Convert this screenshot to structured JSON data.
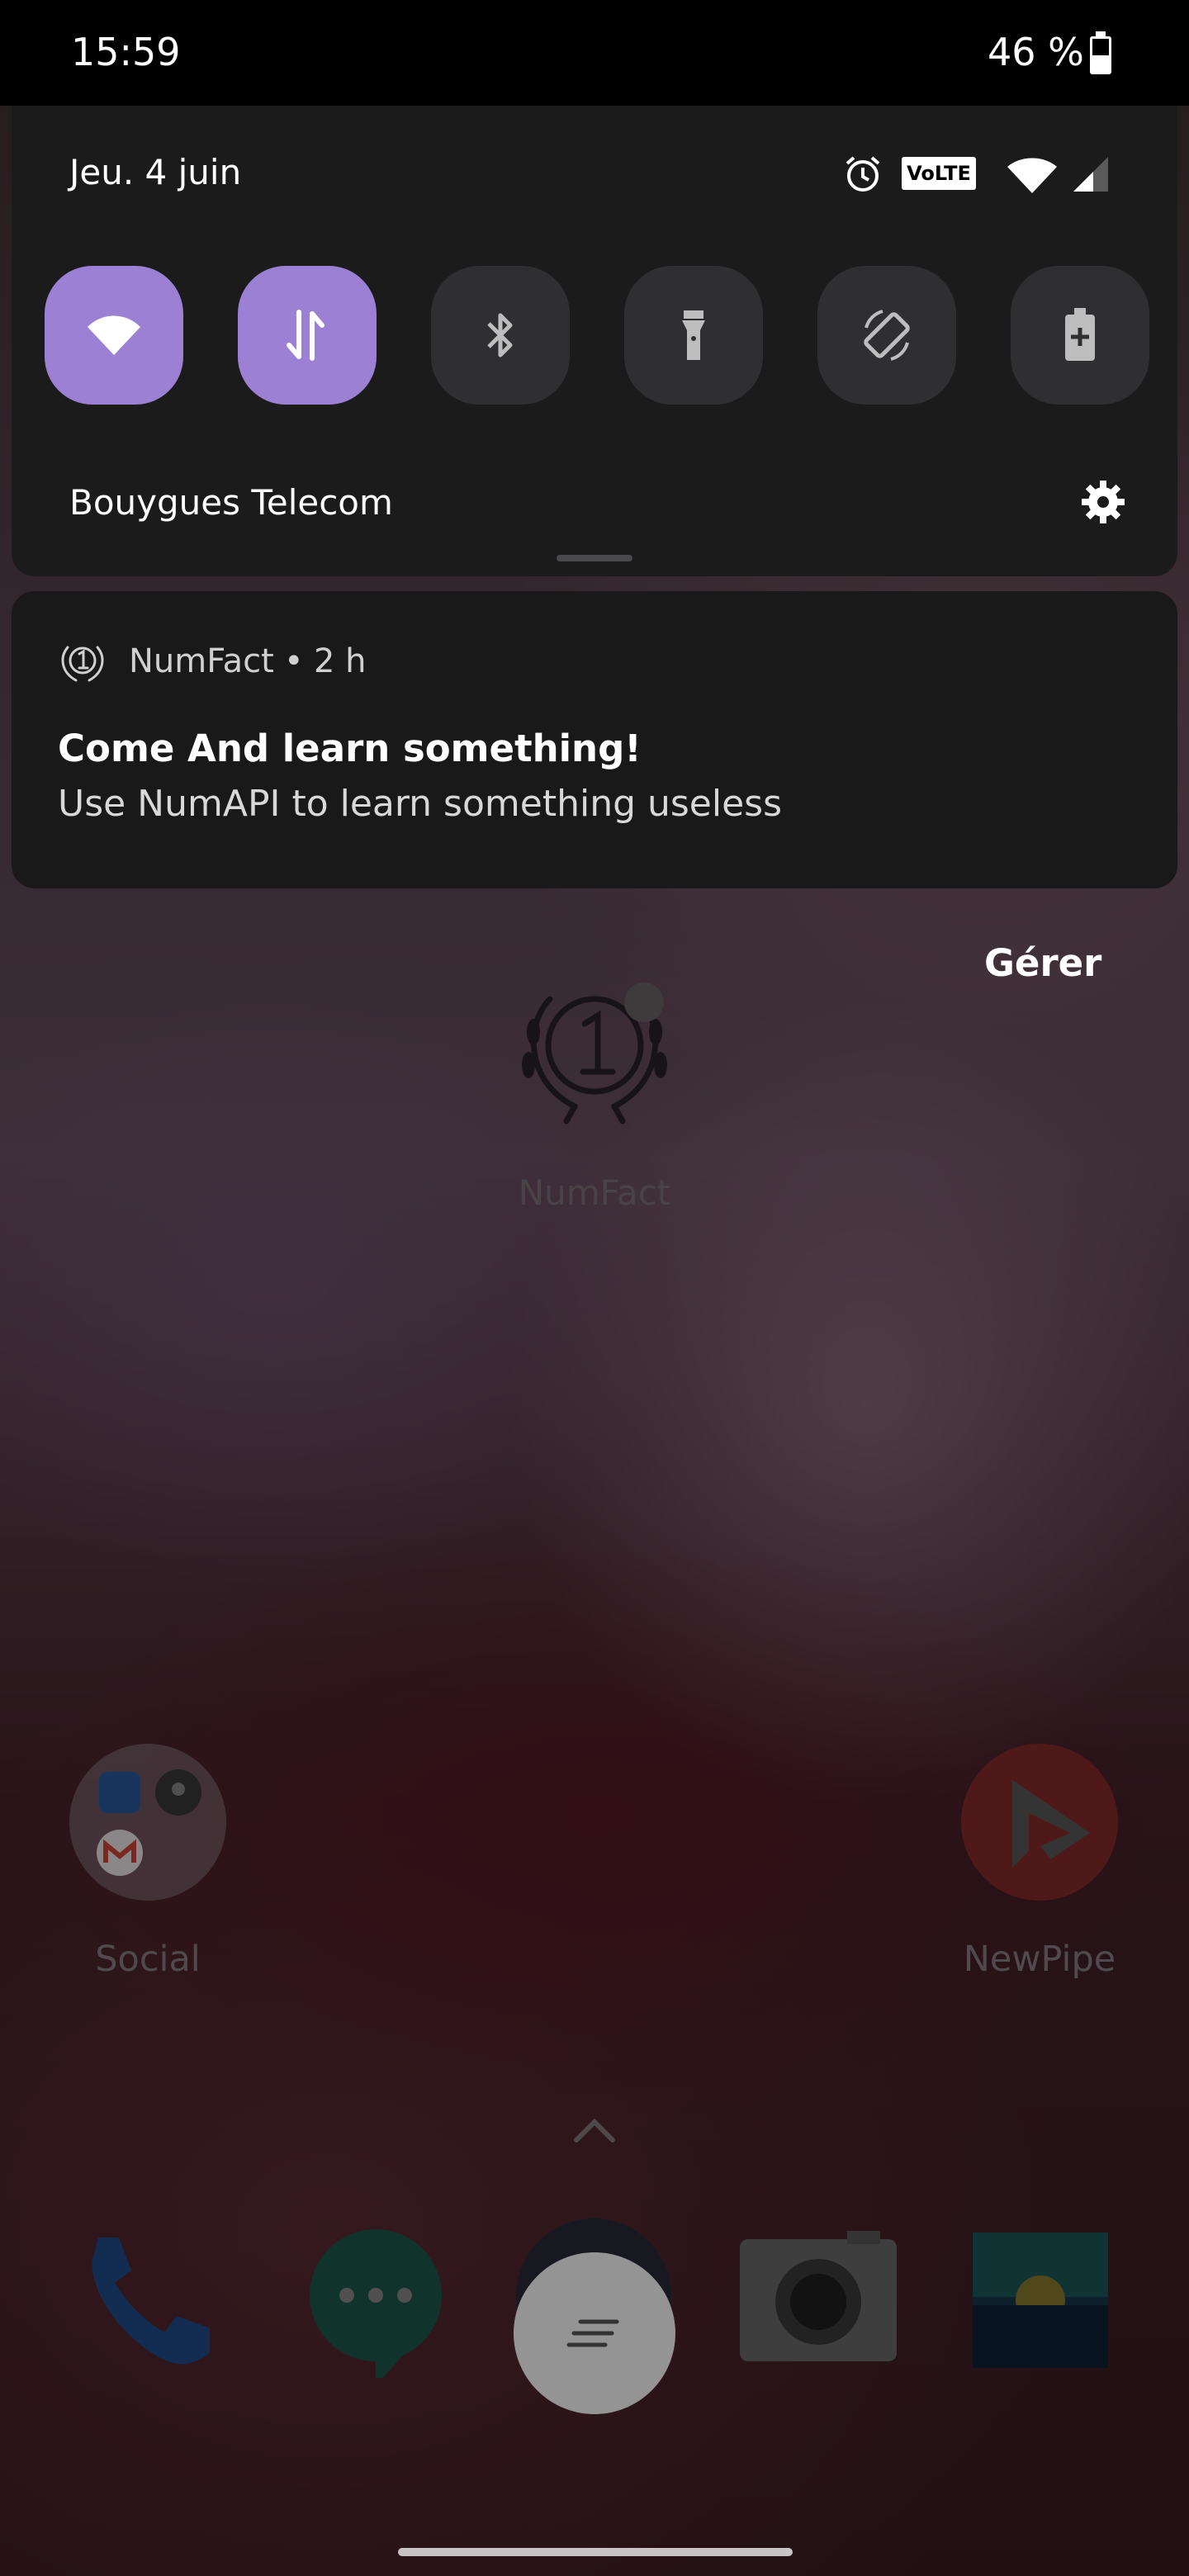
{
  "status_bar": {
    "time": "15:59",
    "battery_text": "46 %"
  },
  "quick_settings": {
    "date": "Jeu. 4 juin",
    "volte_label": "VoLTE",
    "carrier": "Bouygues Telecom",
    "tiles": [
      {
        "name": "wifi",
        "active": true
      },
      {
        "name": "mobile-data",
        "active": true
      },
      {
        "name": "bluetooth",
        "active": false
      },
      {
        "name": "flashlight",
        "active": false
      },
      {
        "name": "auto-rotate",
        "active": false
      },
      {
        "name": "battery-saver",
        "active": false
      }
    ],
    "accent_color": "#9b80d3"
  },
  "notification": {
    "app_name": "NumFact",
    "separator": "•",
    "time": "2 h",
    "title": "Come And learn something!",
    "text": "Use NumAPI to learn something useless"
  },
  "manage_label": "Gérer",
  "home": {
    "numfact_label": "NumFact",
    "social_label": "Social",
    "newpipe_label": "NewPipe",
    "dock": [
      "phone",
      "messages",
      "notes",
      "camera",
      "gallery"
    ]
  }
}
